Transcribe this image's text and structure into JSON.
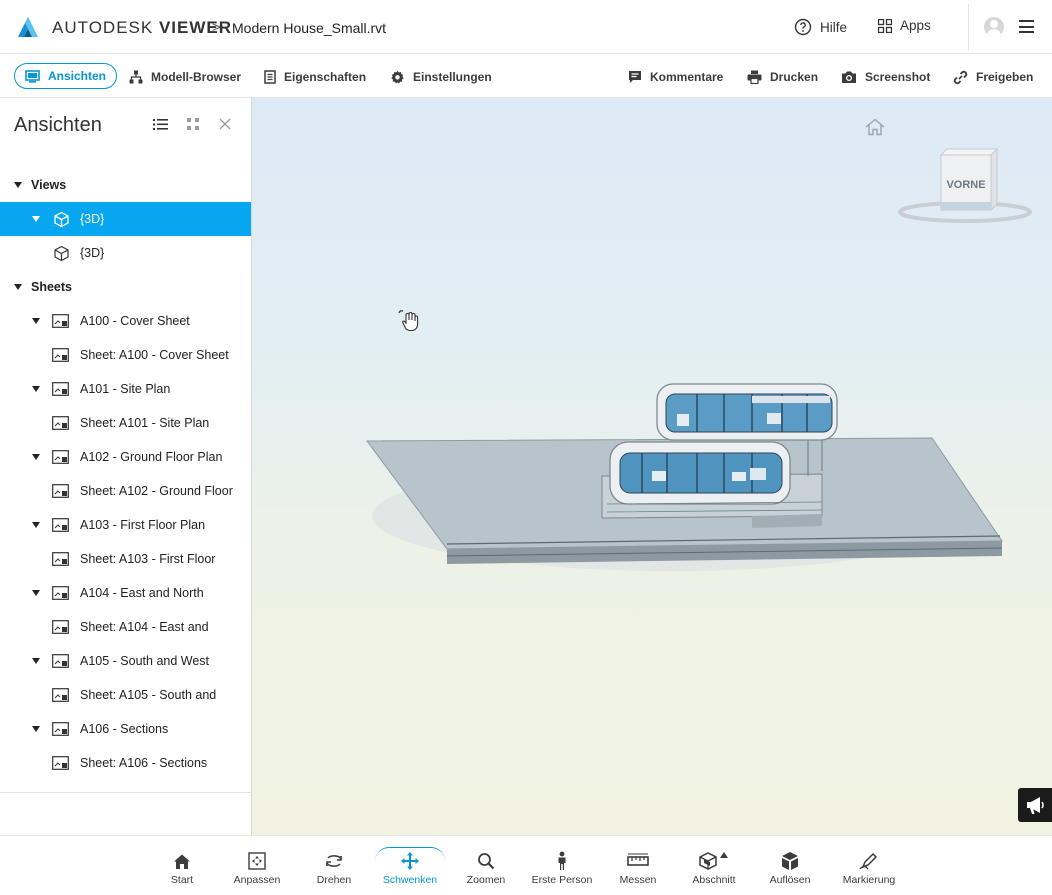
{
  "header": {
    "brand_prefix": "AUTODESK",
    "brand_suffix": "VIEWER",
    "breadcrumb_separator": ">",
    "file_name": "Modern House_Small.rvt",
    "help_label": "Hilfe",
    "apps_label": "Apps"
  },
  "toolbar": {
    "left": [
      {
        "label": "Ansichten",
        "icon": "monitor-icon",
        "active": true
      },
      {
        "label": "Modell-Browser",
        "icon": "model-tree-icon"
      },
      {
        "label": "Eigenschaften",
        "icon": "document-icon"
      },
      {
        "label": "Einstellungen",
        "icon": "gear-icon"
      }
    ],
    "right": [
      {
        "label": "Kommentare",
        "icon": "comment-icon"
      },
      {
        "label": "Drucken",
        "icon": "printer-icon"
      },
      {
        "label": "Screenshot",
        "icon": "camera-icon"
      },
      {
        "label": "Freigeben",
        "icon": "link-icon"
      }
    ]
  },
  "panel": {
    "title": "Ansichten",
    "groups": [
      {
        "label": "Views",
        "items": [
          {
            "label": "{3D}",
            "type": "3d",
            "expandable": true,
            "selected": true
          },
          {
            "label": "{3D}",
            "type": "3d",
            "expandable": false
          }
        ]
      },
      {
        "label": "Sheets",
        "items": [
          {
            "label": "A100 - Cover Sheet",
            "type": "sheet",
            "expandable": true
          },
          {
            "label": "Sheet: A100 - Cover Sheet",
            "type": "sheet",
            "expandable": false
          },
          {
            "label": "A101 - Site Plan",
            "type": "sheet",
            "expandable": true
          },
          {
            "label": "Sheet: A101 - Site Plan",
            "type": "sheet",
            "expandable": false
          },
          {
            "label": "A102 - Ground Floor Plan",
            "type": "sheet",
            "expandable": true
          },
          {
            "label": "Sheet: A102 - Ground Floor",
            "type": "sheet",
            "expandable": false
          },
          {
            "label": "A103 - First Floor Plan",
            "type": "sheet",
            "expandable": true
          },
          {
            "label": "Sheet: A103 - First Floor",
            "type": "sheet",
            "expandable": false
          },
          {
            "label": "A104 - East and North",
            "type": "sheet",
            "expandable": true
          },
          {
            "label": "Sheet: A104 - East and",
            "type": "sheet",
            "expandable": false
          },
          {
            "label": "A105 - South and West",
            "type": "sheet",
            "expandable": true
          },
          {
            "label": "Sheet: A105 - South and",
            "type": "sheet",
            "expandable": false
          },
          {
            "label": "A106 - Sections",
            "type": "sheet",
            "expandable": true
          },
          {
            "label": "Sheet: A106 - Sections",
            "type": "sheet",
            "expandable": false
          }
        ]
      }
    ]
  },
  "viewport": {
    "viewcube_face": "VORNE"
  },
  "tools": [
    {
      "label": "Start",
      "icon": "home-icon"
    },
    {
      "label": "Anpassen",
      "icon": "fit-icon"
    },
    {
      "label": "Drehen",
      "icon": "orbit-icon"
    },
    {
      "label": "Schwenken",
      "icon": "pan-icon",
      "active": true
    },
    {
      "label": "Zoomen",
      "icon": "zoom-icon"
    },
    {
      "label": "Erste Person",
      "icon": "person-icon"
    },
    {
      "label": "Messen",
      "icon": "measure-icon"
    },
    {
      "label": "Abschnitt",
      "icon": "section-icon"
    },
    {
      "label": "Auflösen",
      "icon": "explode-icon"
    },
    {
      "label": "Markierung",
      "icon": "markup-icon"
    }
  ],
  "colors": {
    "accent": "#0696d7",
    "selection": "#06a6f0"
  }
}
